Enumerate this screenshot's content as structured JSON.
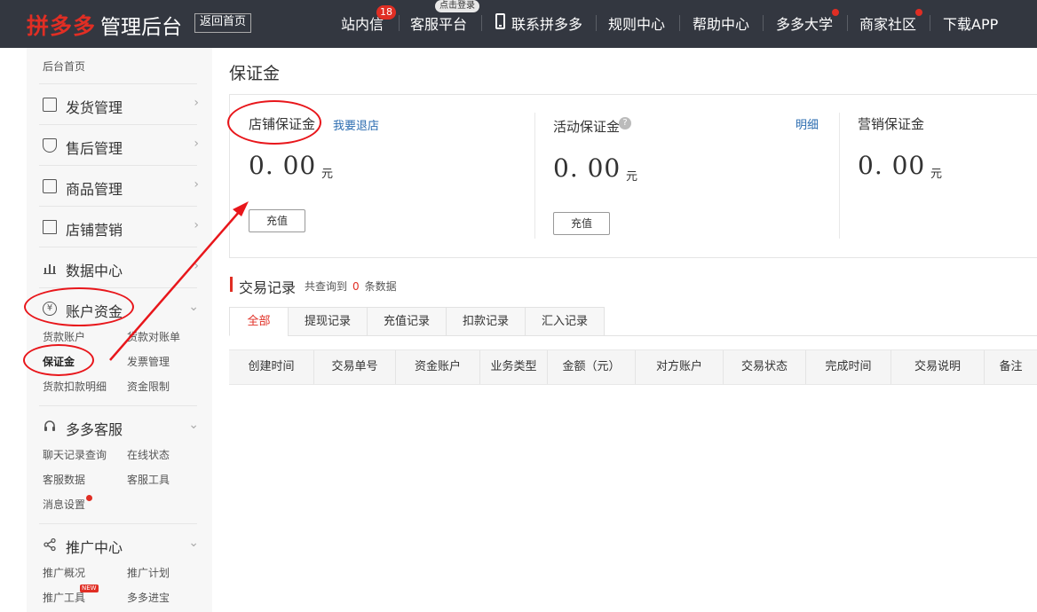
{
  "topbar": {
    "logo_brand": "拼多多",
    "logo_suffix": "管理后台",
    "back_home": "返回首页",
    "nav": [
      {
        "label": "站内信",
        "badge": "18"
      },
      {
        "label": "客服平台",
        "badge": "点击登录"
      },
      {
        "label": "联系拼多多",
        "icon": "phone-icon"
      },
      {
        "label": "规则中心"
      },
      {
        "label": "帮助中心"
      },
      {
        "label": "多多大学",
        "dot": true
      },
      {
        "label": "商家社区",
        "dot": true
      },
      {
        "label": "下载APP"
      }
    ]
  },
  "sidebar": {
    "home": "后台首页",
    "menus": [
      {
        "label": "发货管理",
        "icon": "document-icon"
      },
      {
        "label": "售后管理",
        "icon": "shield-icon"
      },
      {
        "label": "商品管理",
        "icon": "box-icon"
      },
      {
        "label": "店铺营销",
        "icon": "gift-icon"
      },
      {
        "label": "数据中心",
        "icon": "bar-chart-icon"
      },
      {
        "label": "账户资金",
        "icon": "yuan-coin-icon"
      },
      {
        "label": "多多客服",
        "icon": "headset-icon"
      },
      {
        "label": "推广中心",
        "icon": "share-icon"
      }
    ],
    "funds_sub": [
      "货款账户",
      "货款对账单",
      "保证金",
      "发票管理",
      "货款扣款明细",
      "资金限制"
    ],
    "service_sub": [
      "聊天记录查询",
      "在线状态",
      "客服数据",
      "客服工具",
      "消息设置"
    ],
    "promo_sub": [
      "推广概况",
      "推广计划",
      "推广工具",
      "多多进宝"
    ],
    "new_tag": "NEW"
  },
  "main": {
    "title": "保证金",
    "deposits": [
      {
        "label": "店铺保证金",
        "link": "我要退店",
        "amount": "0. 00",
        "unit": "元",
        "button": "充值"
      },
      {
        "label": "活动保证金",
        "link": "明细",
        "amount": "0. 00",
        "unit": "元",
        "button": "充值"
      },
      {
        "label": "营销保证金",
        "amount": "0. 00",
        "unit": "元"
      }
    ],
    "records": {
      "title": "交易记录",
      "count_prefix": "共查询到",
      "count": "0",
      "count_suffix": "条数据",
      "tabs": [
        "全部",
        "提现记录",
        "充值记录",
        "扣款记录",
        "汇入记录"
      ],
      "columns": [
        "创建时间",
        "交易单号",
        "资金账户",
        "业务类型",
        "金额（元）",
        "对方账户",
        "交易状态",
        "完成时间",
        "交易说明",
        "备注"
      ]
    }
  },
  "colors": {
    "brand_red": "#e02e24",
    "topbar_bg": "#333740",
    "link_blue": "#2b6cb0",
    "annotation_red": "#e8161b"
  }
}
